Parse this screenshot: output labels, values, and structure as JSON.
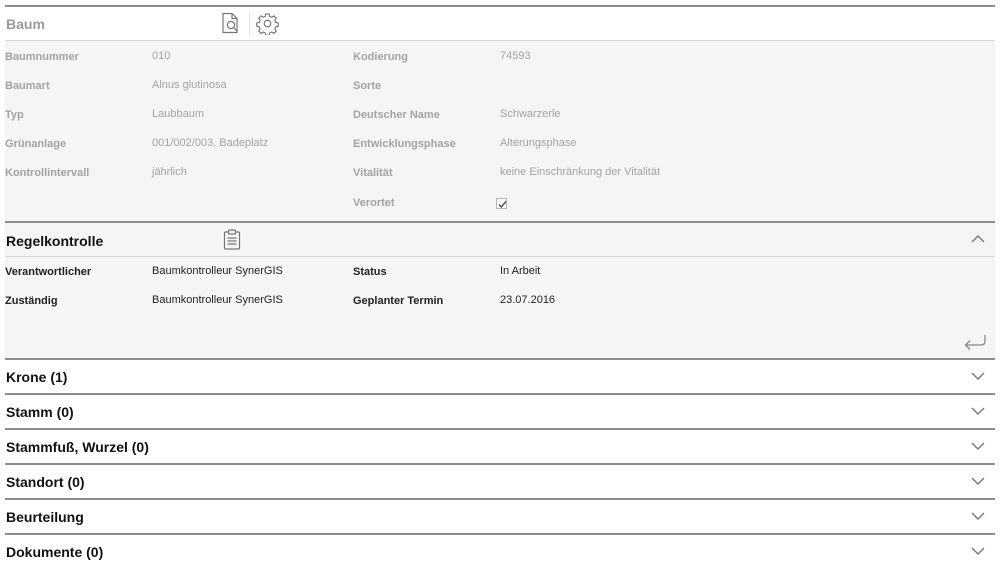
{
  "baum": {
    "title": "Baum",
    "icons": {
      "preview": "document-search-icon",
      "settings": "gear-icon"
    },
    "fields_left": [
      {
        "label": "Baumnummer",
        "value": "010"
      },
      {
        "label": "Baumart",
        "value": "Alnus glutinosa"
      },
      {
        "label": "Typ",
        "value": "Laubbaum"
      },
      {
        "label": "Grünanlage",
        "value": "001/002/003, Badeplatz"
      },
      {
        "label": "Kontrollintervall",
        "value": "jährlich"
      }
    ],
    "fields_right": [
      {
        "label": "Kodierung",
        "value": "74593"
      },
      {
        "label": "Sorte",
        "value": ""
      },
      {
        "label": "Deutscher Name",
        "value": "Schwarzerle"
      },
      {
        "label": "Entwicklungsphase",
        "value": "Alterungsphase"
      },
      {
        "label": "Vitalität",
        "value": "keine Einschränkung der Vitalität"
      }
    ],
    "verortet": {
      "label": "Verortet",
      "checked": true
    }
  },
  "regelkontrolle": {
    "title": "Regelkontrolle",
    "icons": {
      "clipboard": "clipboard-icon",
      "collapse": "chevron-up-icon",
      "return": "return-arrow-icon"
    },
    "fields_left": [
      {
        "label": "Verantwortlicher",
        "value": "Baumkontrolleur SynerGIS"
      },
      {
        "label": "Zuständig",
        "value": "Baumkontrolleur SynerGIS"
      }
    ],
    "fields_right": [
      {
        "label": "Status",
        "value": "In Arbeit"
      },
      {
        "label": "Geplanter Termin",
        "value": "23.07.2016"
      }
    ]
  },
  "sections": [
    {
      "title": "Krone (1)"
    },
    {
      "title": "Stamm (0)"
    },
    {
      "title": "Stammfuß, Wurzel (0)"
    },
    {
      "title": "Standort (0)"
    },
    {
      "title": "Beurteilung"
    },
    {
      "title": "Dokumente (0)"
    }
  ],
  "colors": {
    "header_muted": "#9a9a9a",
    "panel_bg": "#f5f5f5",
    "divider": "#8c8c8c"
  }
}
